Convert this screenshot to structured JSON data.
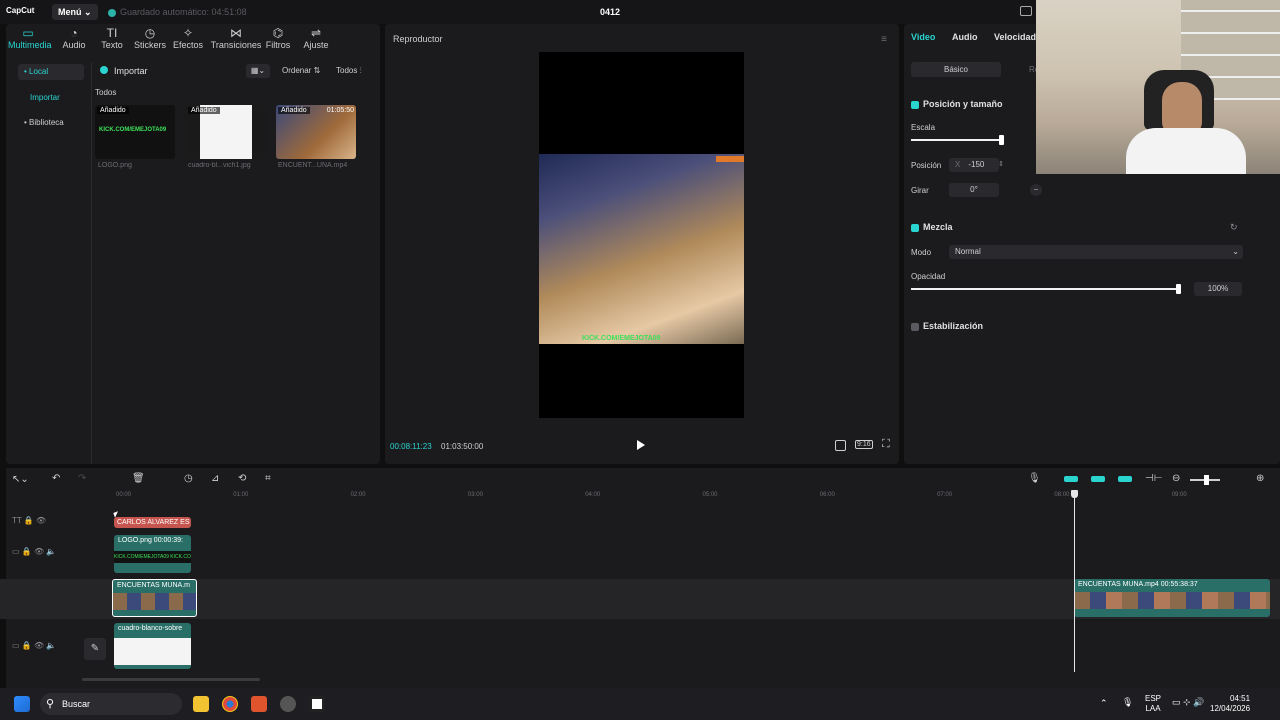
{
  "titlebar": {
    "logo": "CapCut",
    "menu": "Menú",
    "autosave": "Guardado automático: 04:51:08",
    "project": "0412"
  },
  "media_tabs": [
    {
      "label": "Multimedia",
      "icon": "▭"
    },
    {
      "label": "Audio",
      "icon": "◔"
    },
    {
      "label": "Texto",
      "icon": "TI"
    },
    {
      "label": "Stickers",
      "icon": "◷"
    },
    {
      "label": "Efectos",
      "icon": "✧"
    },
    {
      "label": "Transiciones",
      "icon": "⋈"
    },
    {
      "label": "Filtros",
      "icon": "⌬"
    },
    {
      "label": "Ajuste",
      "icon": "⇌"
    }
  ],
  "sidebar": {
    "local": "• Local",
    "importar": "Importar",
    "biblioteca": "• Biblioteca"
  },
  "media": {
    "import": "Importar",
    "sort": "Ordenar",
    "filter": "Todos",
    "section": "Todos",
    "items": [
      {
        "badge": "Añadido",
        "caption": "LOGO.png",
        "inner": "KICK.COM/EMEJOTA09"
      },
      {
        "badge": "Añadido",
        "caption": "cuadro-bl...vich1.jpg"
      },
      {
        "badge": "Añadido",
        "caption": "ENCUENT...UNA.mp4",
        "duration": "01:05:50"
      }
    ]
  },
  "player": {
    "title": "Reproductor",
    "current": "00:08:11:23",
    "total": "01:03:50:00",
    "ratio": "9:16",
    "overlay": "KICK.COM/EMEJOTA09"
  },
  "props": {
    "tabs": [
      "Video",
      "Audio",
      "Velocidad"
    ],
    "subtabs": [
      "Básico",
      "Re"
    ],
    "pos_title": "Posición y tamaño",
    "escala": "Escala",
    "posicion": "Posición",
    "pos_x_label": "X",
    "pos_x": "-150",
    "girar": "Girar",
    "girar_val": "0°",
    "mezcla": "Mezcla",
    "modo": "Modo",
    "modo_val": "Normal",
    "opacidad": "Opacidad",
    "opacidad_val": "100%",
    "estabilizacion": "Estabilización"
  },
  "timeline": {
    "ruler": [
      "00:00",
      "01:00",
      "02:00",
      "03:00",
      "04:00",
      "05:00",
      "06:00",
      "07:00",
      "08:00",
      "09:00"
    ],
    "clips": {
      "text": "CARLOS ALVAREZ ES",
      "logo": "LOGO.png  00:00:39:",
      "logo_strip": "KICK.COM/EMEJOTA09 KICK.COM/EMEJOTA09",
      "main1": "ENCUENTAS MUNA.m",
      "main2": "ENCUENTAS MUNA.mp4  00:55:38:37",
      "white": "cuadro-blanco-sobre"
    }
  },
  "taskbar": {
    "search": "Buscar",
    "lang1": "ESP",
    "lang2": "LAA",
    "time": "04:51",
    "date": "12/04/2026"
  },
  "colors": {
    "accent": "#2ad4cf",
    "textclip": "#c6554f",
    "videoclip": "#2a6f67"
  }
}
